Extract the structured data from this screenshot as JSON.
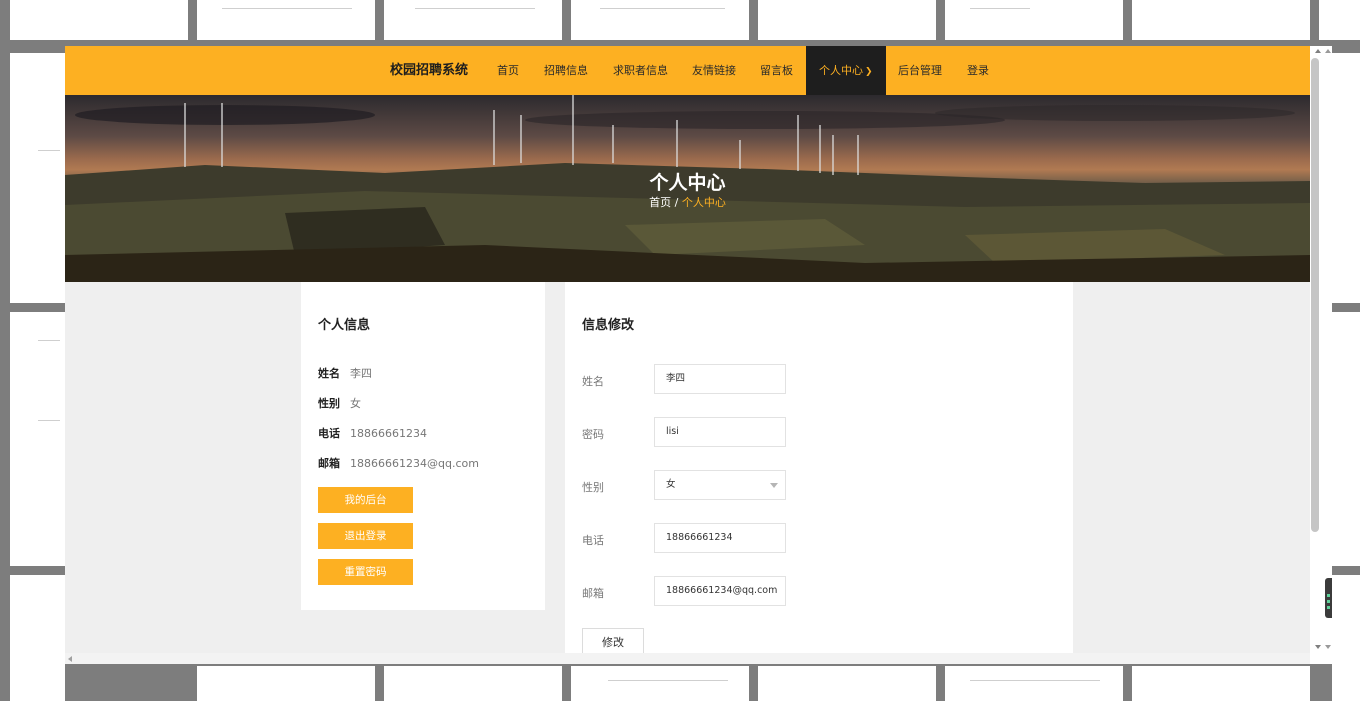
{
  "nav": {
    "brand": "校园招聘系统",
    "items": [
      {
        "label": "首页"
      },
      {
        "label": "招聘信息"
      },
      {
        "label": "求职者信息"
      },
      {
        "label": "友情链接"
      },
      {
        "label": "留言板"
      },
      {
        "label": "个人中心",
        "active": true
      },
      {
        "label": "后台管理"
      },
      {
        "label": "登录"
      }
    ],
    "caret_icon": "chevron-down-icon"
  },
  "hero": {
    "title": "个人中心",
    "breadcrumb_home": "首页",
    "breadcrumb_sep": " / ",
    "breadcrumb_current": "个人中心"
  },
  "profile": {
    "title": "个人信息",
    "rows": [
      {
        "label": "姓名",
        "value": "李四"
      },
      {
        "label": "性别",
        "value": "女"
      },
      {
        "label": "电话",
        "value": "18866661234"
      },
      {
        "label": "邮箱",
        "value": "18866661234@qq.com"
      }
    ],
    "buttons": {
      "dashboard": "我的后台",
      "logout": "退出登录",
      "reset_password": "重置密码"
    }
  },
  "form": {
    "title": "信息修改",
    "fields": {
      "name": {
        "label": "姓名",
        "value": "李四"
      },
      "password": {
        "label": "密码",
        "value": "lisi"
      },
      "gender": {
        "label": "性别",
        "value": "女"
      },
      "phone": {
        "label": "电话",
        "value": "18866661234"
      },
      "email": {
        "label": "邮箱",
        "value": "18866661234@qq.com"
      }
    },
    "submit": "修改"
  },
  "colors": {
    "accent": "#fdb022",
    "nav_active_bg": "#1e1e1e",
    "page_bg": "#efefef"
  }
}
